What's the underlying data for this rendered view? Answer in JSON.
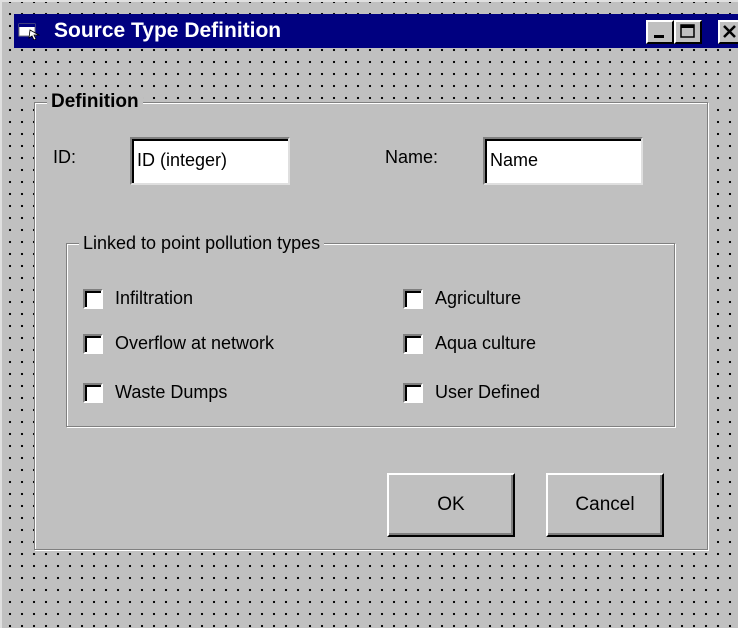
{
  "window": {
    "title": "Source Type Definition",
    "icon": "form-icon",
    "controls": [
      "minimize-icon",
      "maximize-icon",
      "close-icon"
    ]
  },
  "definition": {
    "group_label": "Definition",
    "id_label": "ID:",
    "id_value": "ID (integer)",
    "name_label": "Name:",
    "name_value": "Name"
  },
  "linked": {
    "group_label": "Linked to point pollution types",
    "options": [
      {
        "label": "Infiltration",
        "checked": false
      },
      {
        "label": "Overflow at network",
        "checked": false
      },
      {
        "label": "Waste Dumps",
        "checked": false
      },
      {
        "label": "Agriculture",
        "checked": false
      },
      {
        "label": "Aqua culture",
        "checked": false
      },
      {
        "label": "User Defined",
        "checked": false
      }
    ]
  },
  "buttons": {
    "ok": "OK",
    "cancel": "Cancel"
  },
  "colors": {
    "titlebar": "#000080",
    "face": "#c0c0c0"
  }
}
